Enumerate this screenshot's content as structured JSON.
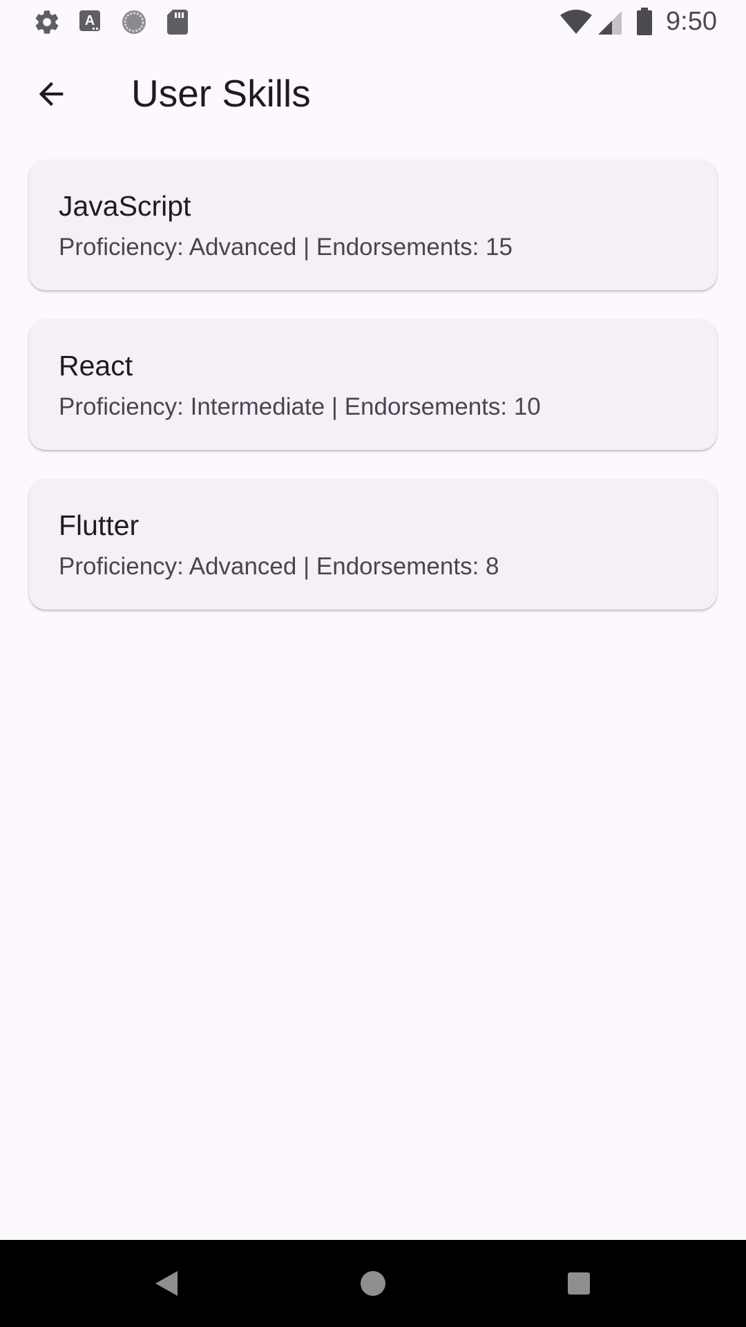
{
  "status_bar": {
    "time": "9:50",
    "left_icons": [
      "settings-icon",
      "font-a-icon",
      "loading-circle-icon",
      "sd-card-icon"
    ],
    "right_icons": [
      "wifi-icon",
      "cell-signal-icon",
      "battery-icon"
    ]
  },
  "app_bar": {
    "title": "User Skills",
    "back_icon": "arrow-left-icon"
  },
  "skills": [
    {
      "name": "JavaScript",
      "meta": "Proficiency: Advanced | Endorsements: 15"
    },
    {
      "name": "React",
      "meta": "Proficiency: Intermediate | Endorsements: 10"
    },
    {
      "name": "Flutter",
      "meta": "Proficiency: Advanced | Endorsements: 8"
    }
  ],
  "nav_bar": {
    "buttons": [
      "back-triangle-icon",
      "home-circle-icon",
      "recents-square-icon"
    ]
  },
  "colors": {
    "background": "#fdf7fe",
    "card": "#f5f0f7",
    "title_text": "#1d1b20",
    "secondary_text": "#49454f",
    "nav_bar": "#000000"
  }
}
